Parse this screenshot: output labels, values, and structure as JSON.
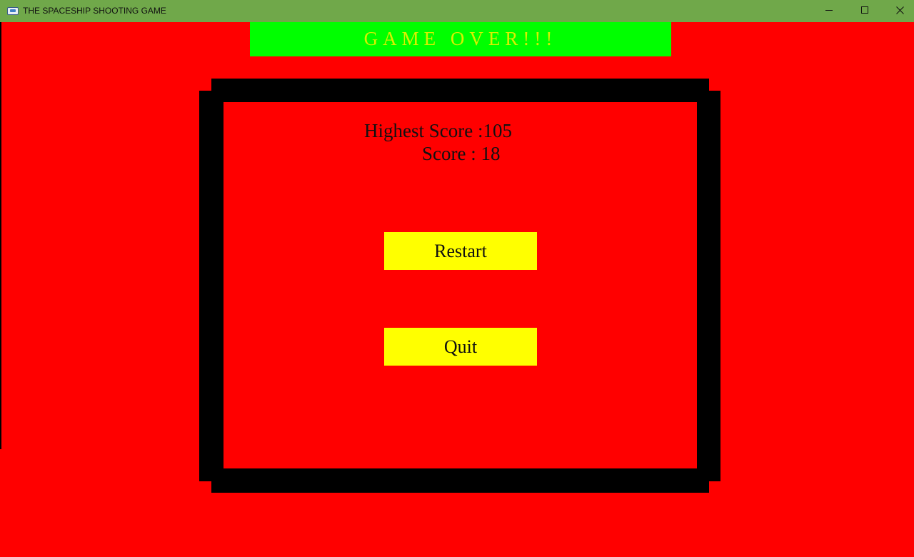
{
  "window": {
    "title": "THE SPACESHIP SHOOTING GAME",
    "icon": "spaceship-app-icon",
    "controls": {
      "minimize_icon": "minimize-icon",
      "maximize_icon": "maximize-icon",
      "close_icon": "close-icon"
    },
    "titlebar_color": "#70a84a"
  },
  "game": {
    "banner": {
      "text": "GAME OVER!!!",
      "background_color": "#00ff00",
      "text_color": "#d8f000"
    },
    "background_color": "#ff0000",
    "frame_color": "#000000",
    "highest_score_text": "Highest Score :105",
    "score_text": "Score : 18",
    "buttons": {
      "restart_label": "Restart",
      "quit_label": "Quit",
      "color": "#ffff00"
    }
  }
}
